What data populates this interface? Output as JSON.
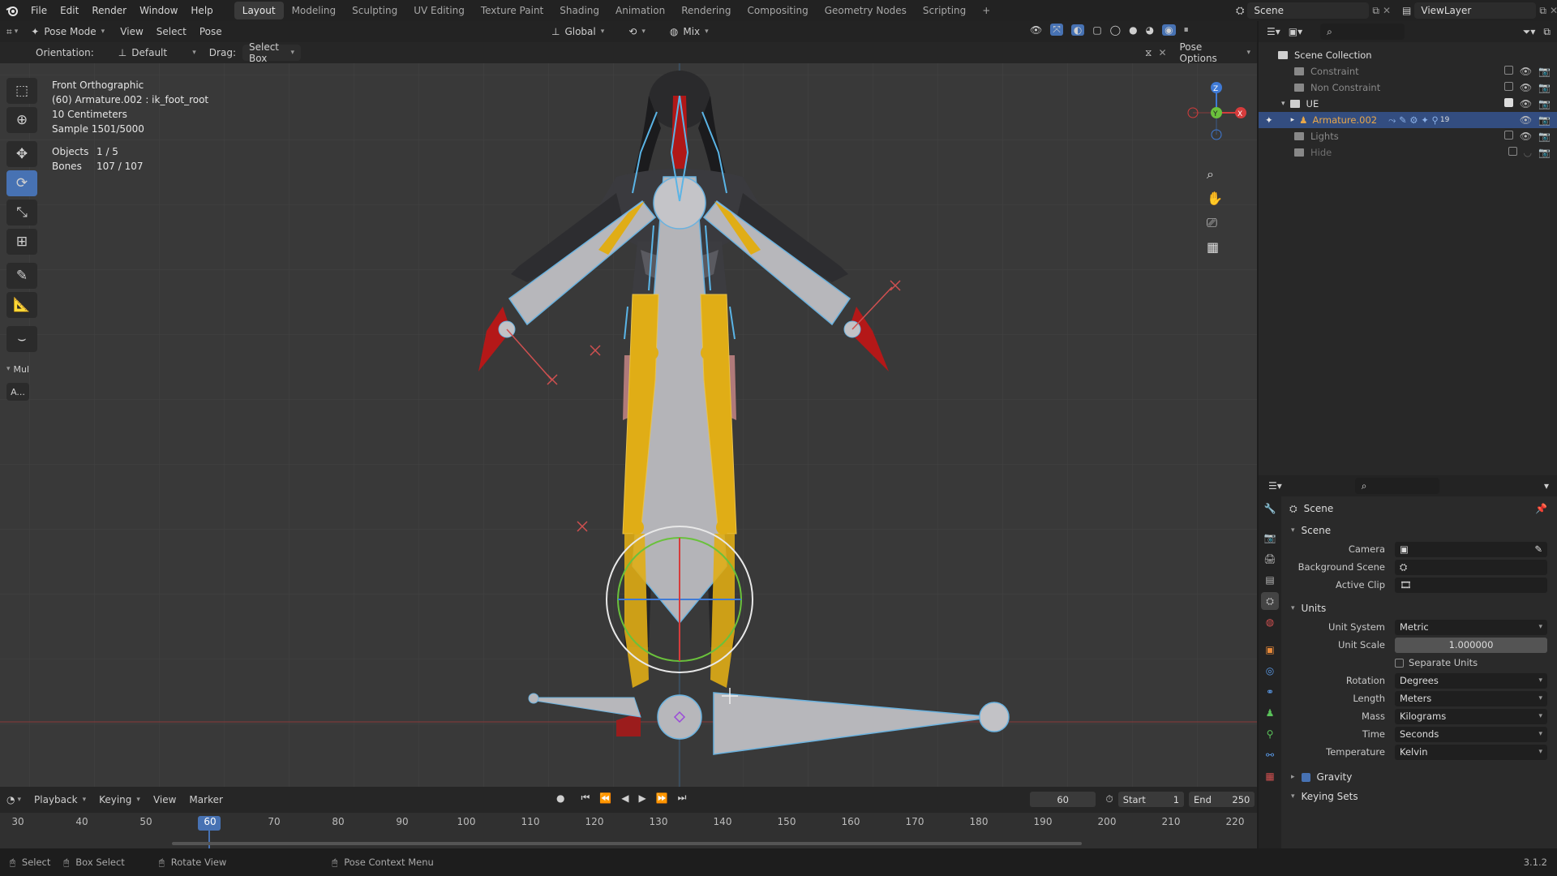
{
  "topbar": {
    "menus": [
      "File",
      "Edit",
      "Render",
      "Window",
      "Help"
    ],
    "workspaces": [
      "Layout",
      "Modeling",
      "Sculpting",
      "UV Editing",
      "Texture Paint",
      "Shading",
      "Animation",
      "Rendering",
      "Compositing",
      "Geometry Nodes",
      "Scripting"
    ],
    "active_workspace": "Layout",
    "add_tab": "+",
    "scene_name": "Scene",
    "view_layer": "ViewLayer"
  },
  "viewport_header": {
    "mode": "Pose Mode",
    "menus": [
      "View",
      "Select",
      "Pose"
    ],
    "transform_orientation": "Global",
    "blend": "Mix"
  },
  "tool_header": {
    "orientation_label": "Orientation:",
    "orientation_value": "Default",
    "drag_label": "Drag:",
    "drag_value": "Select Box",
    "pose_options": "Pose Options"
  },
  "overlay": {
    "view_name": "Front Orthographic",
    "active": "(60) Armature.002 : ik_foot_root",
    "grid_scale": "10 Centimeters",
    "sample": "Sample 1501/5000",
    "objects_label": "Objects",
    "objects_value": "1 / 5",
    "bones_label": "Bones",
    "bones_value": "107 / 107"
  },
  "toolbar_extra": {
    "mul_label": "Mul",
    "a_label": "A..."
  },
  "gizmo": {
    "z": "Z",
    "y": "Y",
    "x": "X"
  },
  "outliner": {
    "root": "Scene Collection",
    "items": [
      {
        "label": "Constraint",
        "checked": false
      },
      {
        "label": "Non Constraint",
        "checked": false
      },
      {
        "label": "UE",
        "checked": true
      },
      {
        "label": "Armature.002",
        "checked": null
      },
      {
        "label": "Lights",
        "checked": false
      },
      {
        "label": "Hide",
        "checked": false
      }
    ],
    "badge": "19"
  },
  "properties": {
    "context": "Scene",
    "scene_panel": "Scene",
    "camera_label": "Camera",
    "bg_scene_label": "Background Scene",
    "active_clip_label": "Active Clip",
    "units_panel": "Units",
    "unit_system_label": "Unit System",
    "unit_system": "Metric",
    "unit_scale_label": "Unit Scale",
    "unit_scale": "1.000000",
    "separate_units": "Separate Units",
    "rotation_label": "Rotation",
    "rotation": "Degrees",
    "length_label": "Length",
    "length": "Meters",
    "mass_label": "Mass",
    "mass": "Kilograms",
    "time_label": "Time",
    "time": "Seconds",
    "temperature_label": "Temperature",
    "temperature": "Kelvin",
    "gravity": "Gravity",
    "keying_sets": "Keying Sets"
  },
  "timeline": {
    "menus": [
      "Playback",
      "Keying",
      "View",
      "Marker"
    ],
    "current_frame": "60",
    "start_label": "Start",
    "start": "1",
    "end_label": "End",
    "end": "250",
    "ticks": [
      "30",
      "40",
      "50",
      "60",
      "70",
      "80",
      "90",
      "100",
      "110",
      "120",
      "130",
      "140",
      "150",
      "160",
      "170",
      "180",
      "190",
      "200",
      "210",
      "220"
    ]
  },
  "statusbar": {
    "select": "Select",
    "box_select": "Box Select",
    "rotate_view": "Rotate View",
    "pose_context": "Pose Context Menu",
    "version": "3.1.2"
  },
  "colors": {
    "accent": "#4772b3",
    "bone_yellow": "#e0ad16",
    "bone_blue": "#5ab4e6",
    "selected_row": "#334d80"
  }
}
